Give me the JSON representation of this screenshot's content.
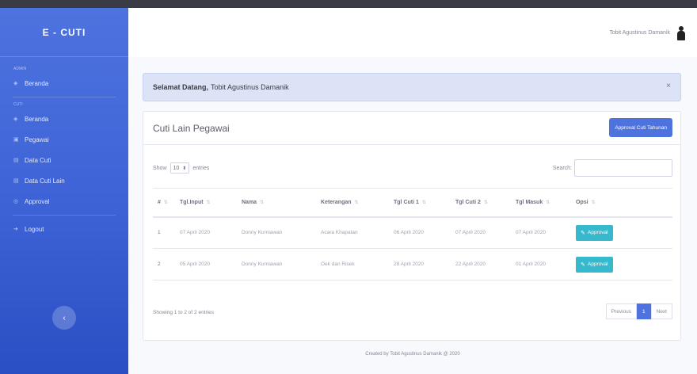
{
  "sidebar": {
    "brand": "E - CUTI",
    "section_1": "ADMIN",
    "section_2": "CUTI",
    "items": [
      {
        "icon": "dashboard-icon",
        "label": "Beranda"
      },
      {
        "icon": "dashboard-icon",
        "label": "Beranda"
      },
      {
        "icon": "users-icon",
        "label": "Pegawai"
      },
      {
        "icon": "table-icon",
        "label": "Data Cuti"
      },
      {
        "icon": "table-icon",
        "label": "Data Cuti Lain"
      },
      {
        "icon": "check-icon",
        "label": "Approval"
      },
      {
        "icon": "logout-icon",
        "label": "Logout"
      }
    ],
    "toggle_glyph": "‹"
  },
  "topbar": {
    "user_name": "Tobit Agustinus Damanik"
  },
  "alert": {
    "greeting": "Selamat Datang,",
    "name": "Tobit Agustinus Damanik",
    "close": "×"
  },
  "card": {
    "title": "Cuti Lain Pegawai",
    "approval_button": "Approval Cuti Tahunan"
  },
  "table_controls": {
    "show": "Show",
    "length_value": "10",
    "entries": "entries",
    "search_label": "Search:"
  },
  "table": {
    "headers": [
      "#",
      "Tgl.Input",
      "Nama",
      "Keterangan",
      "Tgl Cuti 1",
      "Tgl Cuti 2",
      "Tgl Masuk",
      "Opsi"
    ],
    "rows": [
      {
        "no": "1",
        "tgl_input": "07 April 2020",
        "nama": "Donny Kurniawan",
        "keterangan": "Acara Khapatan",
        "cuti1": "06 April 2020",
        "cuti2": "07 April 2020",
        "masuk": "07 April 2020",
        "action": "Approval"
      },
      {
        "no": "2",
        "tgl_input": "05 April 2020",
        "nama": "Donny Kurniawan",
        "keterangan": "Oek dan Risek",
        "cuti1": "28 April 2020",
        "cuti2": "22 April 2020",
        "masuk": "01 April 2020",
        "action": "Approval"
      }
    ]
  },
  "info_text": "Showing 1 to 2 of 2 entries",
  "pagination": {
    "previous": "Previous",
    "current": "1",
    "next": "Next"
  },
  "footer": "Created by Tobit Agustinus Damanik @ 2020",
  "colors": {
    "primary": "#4e73df",
    "info": "#36b9cc",
    "alert_bg": "#dce3f7"
  }
}
